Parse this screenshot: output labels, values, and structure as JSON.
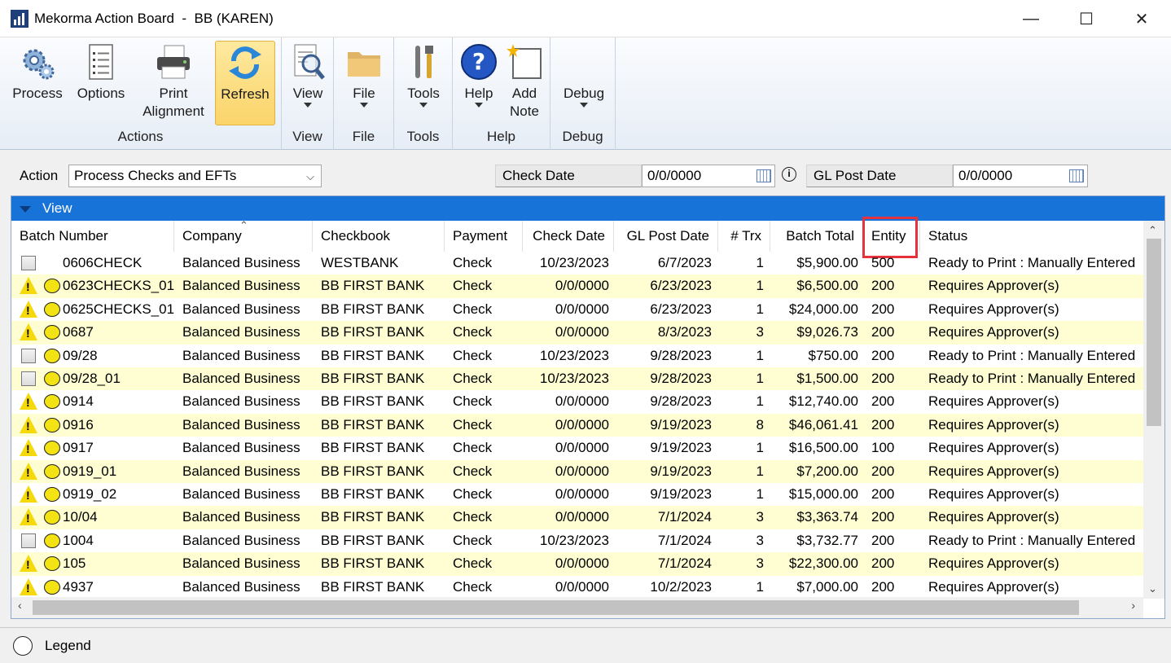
{
  "window": {
    "title": "Mekorma Action Board  -  BB (KAREN)",
    "minimize": "—",
    "maximize": "☐",
    "close": "✕"
  },
  "ribbon": {
    "groups": [
      {
        "label": "Actions",
        "buttons": [
          "Process",
          "Options",
          "Print\nAlignment",
          "Refresh"
        ]
      },
      {
        "label": "View",
        "buttons": [
          "View"
        ]
      },
      {
        "label": "File",
        "buttons": [
          "File"
        ]
      },
      {
        "label": "Tools",
        "buttons": [
          "Tools"
        ]
      },
      {
        "label": "Help",
        "buttons": [
          "Help",
          "Add\nNote"
        ]
      },
      {
        "label": "Debug",
        "buttons": [
          "Debug"
        ]
      }
    ],
    "process": "Process",
    "options": "Options",
    "print_alignment": "Print\nAlignment",
    "refresh": "Refresh",
    "view": "View",
    "file": "File",
    "tools": "Tools",
    "help": "Help",
    "add_note": "Add\nNote",
    "debug": "Debug",
    "group_actions": "Actions",
    "group_view": "View",
    "group_file": "File",
    "group_tools": "Tools",
    "group_help": "Help",
    "group_debug": "Debug"
  },
  "filters": {
    "action_label": "Action",
    "action_value": "Process Checks and EFTs",
    "check_date_label": "Check Date",
    "check_date_value": "0/0/0000",
    "gl_post_date_label": "GL Post Date",
    "gl_post_date_value": "0/0/0000"
  },
  "view_bar": "View",
  "columns": [
    "Batch Number",
    "Company",
    "Checkbook",
    "Payment",
    "Check Date",
    "GL Post Date",
    "# Trx",
    "Batch Total",
    "Entity",
    "Status"
  ],
  "rows": [
    {
      "icon": "checkbox",
      "dot": false,
      "batch": "0606CHECK",
      "company": "Balanced Business",
      "checkbook": "WESTBANK",
      "payment": "Check",
      "check_date": "10/23/2023",
      "gl_date": "6/7/2023",
      "trx": "1",
      "total": "$5,900.00",
      "entity": "500",
      "status": "Ready to Print : Manually Entered"
    },
    {
      "icon": "warning",
      "dot": true,
      "batch": "0623CHECKS_01",
      "company": "Balanced Business",
      "checkbook": "BB FIRST BANK",
      "payment": "Check",
      "check_date": "0/0/0000",
      "gl_date": "6/23/2023",
      "trx": "1",
      "total": "$6,500.00",
      "entity": "200",
      "status": "Requires Approver(s)"
    },
    {
      "icon": "warning",
      "dot": true,
      "batch": "0625CHECKS_01",
      "company": "Balanced Business",
      "checkbook": "BB FIRST BANK",
      "payment": "Check",
      "check_date": "0/0/0000",
      "gl_date": "6/23/2023",
      "trx": "1",
      "total": "$24,000.00",
      "entity": "200",
      "status": "Requires Approver(s)"
    },
    {
      "icon": "warning",
      "dot": true,
      "batch": "0687",
      "company": "Balanced Business",
      "checkbook": "BB FIRST BANK",
      "payment": "Check",
      "check_date": "0/0/0000",
      "gl_date": "8/3/2023",
      "trx": "3",
      "total": "$9,026.73",
      "entity": "200",
      "status": "Requires Approver(s)"
    },
    {
      "icon": "checkbox",
      "dot": true,
      "batch": "09/28",
      "company": "Balanced Business",
      "checkbook": "BB FIRST BANK",
      "payment": "Check",
      "check_date": "10/23/2023",
      "gl_date": "9/28/2023",
      "trx": "1",
      "total": "$750.00",
      "entity": "200",
      "status": "Ready to Print : Manually Entered"
    },
    {
      "icon": "checkbox",
      "dot": true,
      "batch": "09/28_01",
      "company": "Balanced Business",
      "checkbook": "BB FIRST BANK",
      "payment": "Check",
      "check_date": "10/23/2023",
      "gl_date": "9/28/2023",
      "trx": "1",
      "total": "$1,500.00",
      "entity": "200",
      "status": "Ready to Print : Manually Entered"
    },
    {
      "icon": "warning",
      "dot": true,
      "batch": "0914",
      "company": "Balanced Business",
      "checkbook": "BB FIRST BANK",
      "payment": "Check",
      "check_date": "0/0/0000",
      "gl_date": "9/28/2023",
      "trx": "1",
      "total": "$12,740.00",
      "entity": "200",
      "status": "Requires Approver(s)"
    },
    {
      "icon": "warning",
      "dot": true,
      "batch": "0916",
      "company": "Balanced Business",
      "checkbook": "BB FIRST BANK",
      "payment": "Check",
      "check_date": "0/0/0000",
      "gl_date": "9/19/2023",
      "trx": "8",
      "total": "$46,061.41",
      "entity": "200",
      "status": "Requires Approver(s)"
    },
    {
      "icon": "warning",
      "dot": true,
      "batch": "0917",
      "company": "Balanced Business",
      "checkbook": "BB FIRST BANK",
      "payment": "Check",
      "check_date": "0/0/0000",
      "gl_date": "9/19/2023",
      "trx": "1",
      "total": "$16,500.00",
      "entity": "100",
      "status": "Requires Approver(s)"
    },
    {
      "icon": "warning",
      "dot": true,
      "batch": "0919_01",
      "company": "Balanced Business",
      "checkbook": "BB FIRST BANK",
      "payment": "Check",
      "check_date": "0/0/0000",
      "gl_date": "9/19/2023",
      "trx": "1",
      "total": "$7,200.00",
      "entity": "200",
      "status": "Requires Approver(s)"
    },
    {
      "icon": "warning",
      "dot": true,
      "batch": "0919_02",
      "company": "Balanced Business",
      "checkbook": "BB FIRST BANK",
      "payment": "Check",
      "check_date": "0/0/0000",
      "gl_date": "9/19/2023",
      "trx": "1",
      "total": "$15,000.00",
      "entity": "200",
      "status": "Requires Approver(s)"
    },
    {
      "icon": "warning",
      "dot": true,
      "batch": "10/04",
      "company": "Balanced Business",
      "checkbook": "BB FIRST BANK",
      "payment": "Check",
      "check_date": "0/0/0000",
      "gl_date": "7/1/2024",
      "trx": "3",
      "total": "$3,363.74",
      "entity": "200",
      "status": "Requires Approver(s)"
    },
    {
      "icon": "checkbox",
      "dot": true,
      "batch": "1004",
      "company": "Balanced Business",
      "checkbook": "BB FIRST BANK",
      "payment": "Check",
      "check_date": "10/23/2023",
      "gl_date": "7/1/2024",
      "trx": "3",
      "total": "$3,732.77",
      "entity": "200",
      "status": "Ready to Print : Manually Entered"
    },
    {
      "icon": "warning",
      "dot": true,
      "batch": "105",
      "company": "Balanced Business",
      "checkbook": "BB FIRST BANK",
      "payment": "Check",
      "check_date": "0/0/0000",
      "gl_date": "7/1/2024",
      "trx": "3",
      "total": "$22,300.00",
      "entity": "200",
      "status": "Requires Approver(s)"
    },
    {
      "icon": "warning",
      "dot": true,
      "batch": "4937",
      "company": "Balanced Business",
      "checkbook": "BB FIRST BANK",
      "payment": "Check",
      "check_date": "0/0/0000",
      "gl_date": "10/2/2023",
      "trx": "1",
      "total": "$7,000.00",
      "entity": "200",
      "status": "Requires Approver(s)"
    }
  ],
  "footer": {
    "legend": "Legend"
  },
  "colors": {
    "accent": "#1773d8",
    "highlight_row": "#fefed2",
    "entity_highlight": "#e5323d",
    "warning": "#f5d90a"
  }
}
